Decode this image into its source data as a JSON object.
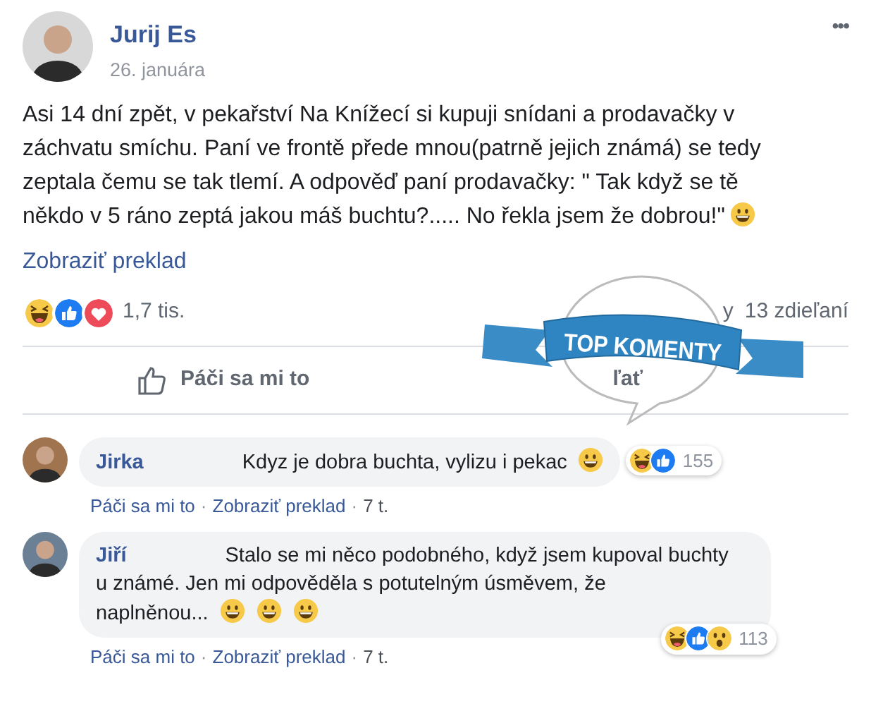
{
  "post": {
    "author": "Jurij Es",
    "date": "26. januára",
    "menu": "•••",
    "text_lines": [
      "Asi 14 dní zpět, v pekařství Na Knížecí si kupuji snídani a prodavačky v",
      "záchvatu smíchu. Paní ve frontě přede mnou(patrně jejich známá) se tedy",
      "zeptala čemu se tak tlemí. A odpověď paní prodavačky: \" Tak když se tě",
      "někdo v 5 ráno zeptá jakou máš buchtu?..... No řekla jsem že dobrou!\""
    ],
    "trailing_icons": [
      {
        "kind": "grin"
      }
    ],
    "translate_link": "Zobraziť preklad",
    "reactions": [
      {
        "kind": "haha"
      },
      {
        "kind": "like"
      },
      {
        "kind": "love"
      }
    ],
    "reactions_count": "1,7 tis.",
    "comments_partial": "y",
    "shares": "13 zdieľaní",
    "like_button": "Páči sa mi to",
    "share_button_partial": "ľať"
  },
  "sticker": {
    "text": "TOP KOMENTY"
  },
  "comments": [
    {
      "author": "Jirka",
      "text_lines": [
        "Kdyz je dobra buchta, vylizu i pekac"
      ],
      "trailing_icons": [
        {
          "kind": "grin"
        }
      ],
      "reactions": [
        {
          "kind": "haha"
        },
        {
          "kind": "like"
        }
      ],
      "reactions_count": "155",
      "actions": [
        "Páči sa mi to",
        "Zobraziť preklad",
        "7 t."
      ],
      "separator": "·"
    },
    {
      "author": "Jiří",
      "text_lines": [
        "Stalo se mi něco podobného, když jsem kupoval buchty",
        "u známé. Jen mi odpověděla s potutelným úsměvem, že",
        "naplněnou..."
      ],
      "trailing_icons": [
        {
          "kind": "grin"
        },
        {
          "kind": "grin"
        },
        {
          "kind": "grin"
        }
      ],
      "reactions": [
        {
          "kind": "haha"
        },
        {
          "kind": "like"
        },
        {
          "kind": "wow"
        }
      ],
      "reactions_count": "113",
      "actions": [
        "Páči sa mi to",
        "Zobraziť preklad",
        "7 t."
      ],
      "separator": "·"
    }
  ]
}
